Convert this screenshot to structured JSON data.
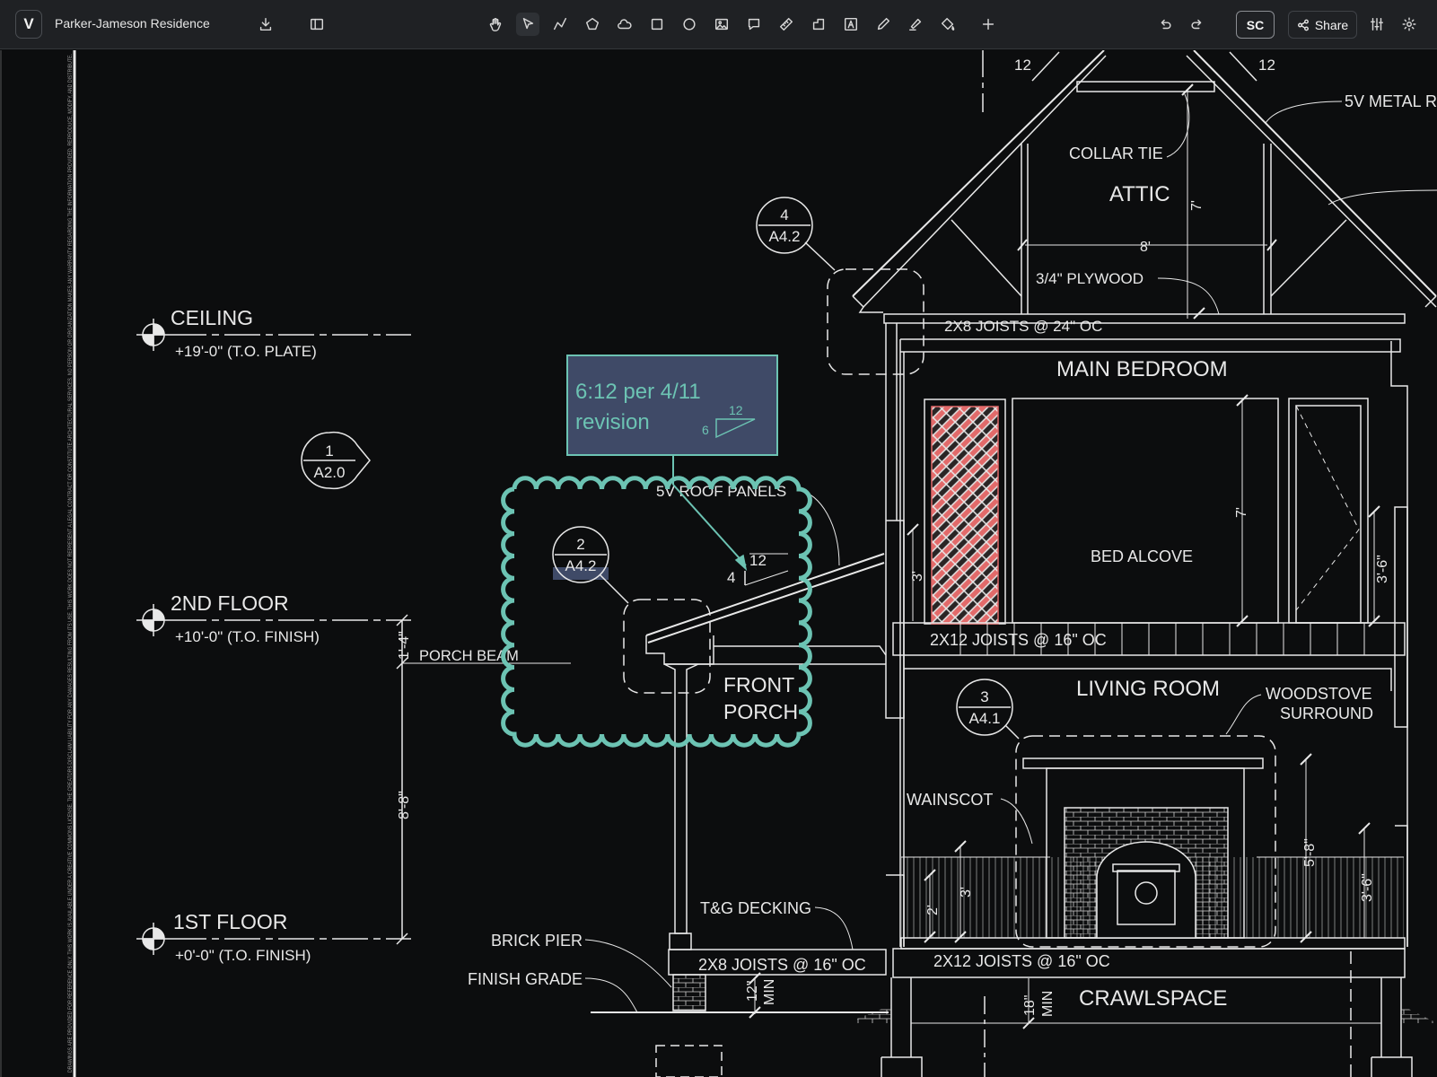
{
  "app": {
    "logo": "V",
    "title": "Parker-Jameson Residence"
  },
  "toolbar": {
    "left_icons": [
      "download-icon",
      "sidebar-toggle-icon"
    ],
    "tools": [
      "hand-icon",
      "select-pointer-icon",
      "polyline-icon",
      "polygon-icon",
      "cloud-icon",
      "rectangle-icon",
      "ellipse-icon",
      "image-icon",
      "comment-icon",
      "measure-icon",
      "area-icon",
      "text-box-icon",
      "pen-icon",
      "highlighter-icon",
      "fill-icon",
      "add-icon"
    ],
    "active_tool": "select-pointer-icon",
    "undo_icon": "undo-icon",
    "redo_icon": "redo-icon",
    "avatar": "SC",
    "share_label": "Share",
    "right_icons": [
      "sliders-icon",
      "settings-icon"
    ]
  },
  "colors": {
    "markup": "#6cc3b3",
    "callout_fill": "#3f4a67",
    "hatch": "#e26a6a",
    "linework": "#e8e8e8"
  },
  "drawing": {
    "sidebar_disclaimer": "DRAWINGS ARE PROVIDED FOR REFERENCE ONLY. THIS WORK IS AVAILABLE UNDER A CREATIVE COMMONS LICENSE. THE CREATORS DISCLAIM LIABILITY FOR ANY DAMAGES RESULTING FROM ITS USE. THIS WORK DOES NOT REPRESENT A LEGAL CONTRACT OR CONSTITUTE ARCHITECTURAL SERVICES. NO PERSON OR ORGANIZATION MAKES ANY WARRANTY REGARDING THE INFORMATION PROVIDED. REPRODUCE, MODIFY, AND DISTRIBUTE.",
    "levels": [
      {
        "name": "CEILING",
        "elevation": "+19'-0\" (T.O. PLATE)"
      },
      {
        "name": "2ND FLOOR",
        "elevation": "+10'-0\" (T.O. FINISH)"
      },
      {
        "name": "1ST FLOOR",
        "elevation": "+0'-0\" (T.O. FINISH)"
      }
    ],
    "section_markers": [
      {
        "num": "1",
        "sheet": "A2.0"
      },
      {
        "num": "4",
        "sheet": "A4.2"
      },
      {
        "num": "2",
        "sheet": "A4.2"
      },
      {
        "num": "3",
        "sheet": "A4.1"
      }
    ],
    "callout": {
      "line1": "6:12 per 4/11",
      "line2": "revision",
      "slope_rise": "6",
      "slope_run": "12"
    },
    "rooms": {
      "attic": "ATTIC",
      "main_bedroom": "MAIN BEDROOM",
      "bed_alcove": "BED ALCOVE",
      "living_room": "LIVING ROOM",
      "crawlspace": "CRAWLSPACE",
      "front_porch_1": "FRONT",
      "front_porch_2": "PORCH"
    },
    "notes": {
      "collar_tie": "COLLAR TIE",
      "metal_roof": "5V METAL R",
      "plywood": "3/4\" PLYWOOD",
      "joists_attic": "2X8 JOISTS @ 24\" OC",
      "joists_2nd": "2X12 JOISTS @ 16\" OC",
      "joists_1st": "2X12 JOISTS @ 16\" OC",
      "joists_porch": "2X8 JOISTS @ 16\" OC",
      "roof_panels": "5V ROOF PANELS",
      "porch_beam": "PORCH BEAM",
      "woodstove_1": "WOODSTOVE",
      "woodstove_2": "SURROUND",
      "wainscot": "WAINSCOT",
      "tg_decking": "T&G DECKING",
      "brick_pier": "BRICK PIER",
      "finish_grade": "FINISH GRADE"
    },
    "dims": {
      "roof_pitch_left": "12",
      "roof_pitch_right": "12",
      "attic_h": "7'",
      "attic_w": "8'",
      "porch_pitch_run": "12",
      "porch_pitch_rise": "4",
      "porch_head": "1'-4\"",
      "porch_clear": "8'-8\"",
      "bed_left": "3'",
      "bed_h": "7'",
      "bed_right": "3'-6\"",
      "living_2": "2'",
      "living_3": "3'",
      "living_58": "5'-8\"",
      "living_36": "3'-6\"",
      "porch_min_1": "12\"",
      "porch_min_2": "MIN",
      "crawl_min_1": "18\"",
      "crawl_min_2": "MIN"
    }
  }
}
